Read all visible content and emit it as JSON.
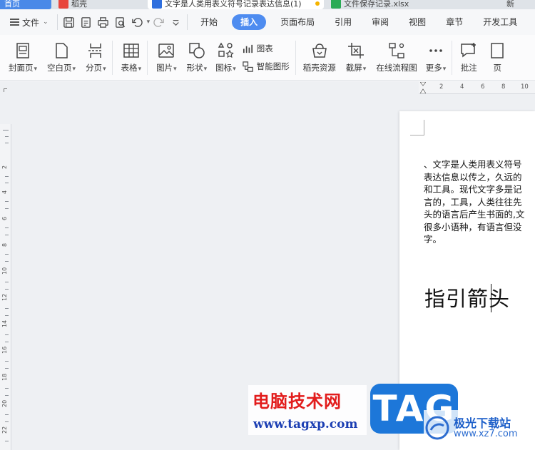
{
  "tabs": [
    {
      "label": "首页"
    },
    {
      "label": "稻壳"
    },
    {
      "label": "文字是人类用表义符号记录表达信息(1)"
    },
    {
      "label": "文件保存记录.xlsx"
    },
    {
      "label": "新"
    }
  ],
  "menu": {
    "file_label": "文件",
    "items": [
      "开始",
      "插入",
      "页面布局",
      "引用",
      "审阅",
      "视图",
      "章节",
      "开发工具"
    ],
    "active": "插入"
  },
  "ribbon": {
    "cover": "封面页",
    "blank": "空白页",
    "pagebreak": "分页",
    "table": "表格",
    "picture": "图片",
    "shape": "形状",
    "icon": "图标",
    "chart": "图表",
    "smartart": "智能图形",
    "docer": "稻壳资源",
    "screenshot": "截屏",
    "flowchart": "在线流程图",
    "more": "更多",
    "comment": "批注",
    "page": "页"
  },
  "ruler": {
    "h_numbers": [
      "2",
      "4",
      "6",
      "8",
      "10"
    ],
    "v_numbers": [
      "2",
      "4",
      "6",
      "8",
      "10",
      "12",
      "14",
      "16",
      "18",
      "20",
      "22"
    ]
  },
  "document": {
    "lines": [
      "、文字是人类用表义符号",
      "表达信息以传之，久远的",
      "和工具。现代文字多是记",
      "言的，工具，人类往往先",
      "头的语言后产生书面的,文",
      "很多小语种，有语言但没",
      "字。"
    ],
    "heading": "指引箭头"
  },
  "watermark": {
    "title": "电脑技术网",
    "url": "www.tagxp.com",
    "tag": "TAG",
    "site_title": "极光下载站",
    "site_url": "www.xz7.com"
  }
}
